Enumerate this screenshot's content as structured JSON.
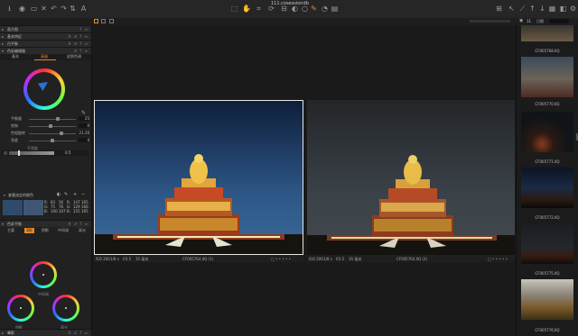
{
  "window": {
    "title": "111.cosessiondb"
  },
  "toolbar": {
    "left_icons": [
      "import-icon",
      "capture-icon",
      "folder-icon",
      "delete-icon",
      "undo-icon",
      "redo-icon",
      "copy-adjust-icon",
      "text-icon"
    ],
    "center_icons": [
      "select-icon",
      "pan-icon",
      "crop-icon",
      "rotate-icon",
      "keystone-icon",
      "mask-icon",
      "spot-icon",
      "picker-icon",
      "brush-icon",
      "eraser-icon",
      "gradient-icon",
      "annotate-icon"
    ],
    "right_icons": [
      "grid-icon",
      "before-after-icon",
      "loupe-icon",
      "proof-icon",
      "focus-icon",
      "warning-icon",
      "cursor-icon",
      "copy-icon",
      "paste-icon",
      "settings-icon"
    ]
  },
  "subbar": {
    "count": "11",
    "sort_label": "日期",
    "search_placeholder": "",
    "zoom_value": "100%"
  },
  "left_panel": {
    "sections": [
      {
        "label": "直方图"
      },
      {
        "label": "基本特征"
      },
      {
        "label": "白平衡"
      },
      {
        "label": "色彩编辑器"
      }
    ],
    "color_editor_tabs": [
      "基本",
      "高级",
      "皮肤色调"
    ],
    "sliders": [
      {
        "label": "平衡量",
        "value": "25",
        "pos": 0.62
      },
      {
        "label": "饱和",
        "value": "0",
        "pos": 0.45
      },
      {
        "label": "色相旋转",
        "value": "21.26",
        "pos": 0.7
      },
      {
        "label": "亮度",
        "value": "4",
        "pos": 0.5
      }
    ],
    "uniformity_label": "平滑度",
    "uniformity_value": "0.5",
    "swatch_section_label": "查看选定的颜色",
    "color_readout": [
      [
        "R:",
        "83",
        "56",
        "R:",
        "147",
        "165"
      ],
      [
        "G:",
        "75",
        "76",
        "G:",
        "129",
        "166"
      ],
      [
        "B:",
        "100",
        "107",
        "B:",
        "155",
        "165"
      ]
    ],
    "balance_section_label": "色彩平衡",
    "balance_tabs": [
      "主要",
      "3向",
      "阴影",
      "中间调",
      "高光"
    ],
    "wheel_labels": [
      "中间调",
      "阴影",
      "高光"
    ],
    "bottom_section_label": "晕影"
  },
  "viewer": {
    "left_photo": {
      "caption": "CF005764.IIQ (1)",
      "meta": [
        "ISO 200",
        "1/8 s",
        "f/3.5",
        "35 毫米"
      ],
      "selected": true
    },
    "right_photo": {
      "caption": "CF005764.IIQ (2)",
      "meta": [
        "ISO 200",
        "1/8 s",
        "f/3.5",
        "35 毫米"
      ],
      "selected": false
    }
  },
  "browser": {
    "thumbnails": [
      {
        "name": "CF005768.IIQ"
      },
      {
        "name": "CF005770.IIQ"
      },
      {
        "name": "CF005771.IIQ"
      },
      {
        "name": "CF005772.IIQ"
      },
      {
        "name": "CF005775.IIQ"
      },
      {
        "name": "CF005776.IIQ"
      }
    ]
  },
  "colors": {
    "accent": "#e08b2c",
    "panel_bg": "#212121",
    "viewer_bg": "#1a1a1a",
    "sky_blue": "#2d4a6e"
  }
}
